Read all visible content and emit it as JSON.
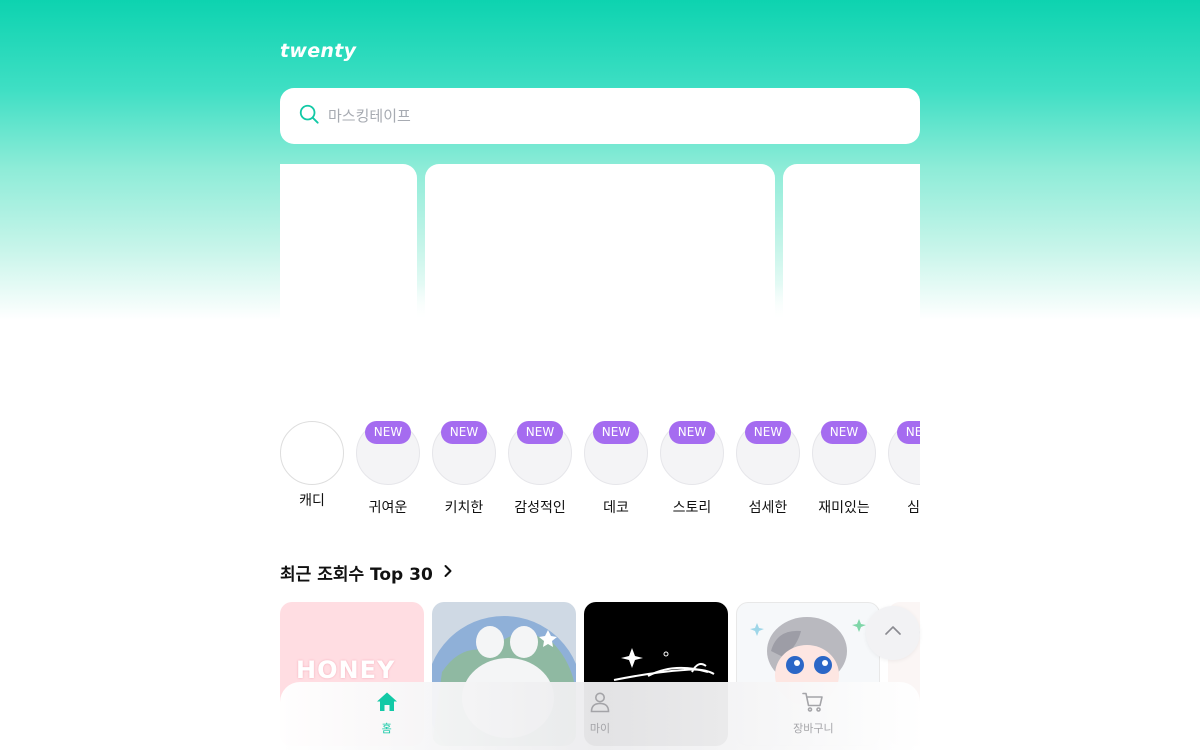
{
  "app": {
    "logo": "twenty"
  },
  "search": {
    "placeholder": "마스킹테이프"
  },
  "categories": [
    {
      "label": "캐디",
      "badge": ""
    },
    {
      "label": "귀여운",
      "badge": "NEW"
    },
    {
      "label": "키치한",
      "badge": "NEW"
    },
    {
      "label": "감성적인",
      "badge": "NEW"
    },
    {
      "label": "데코",
      "badge": "NEW"
    },
    {
      "label": "스토리",
      "badge": "NEW"
    },
    {
      "label": "섬세한",
      "badge": "NEW"
    },
    {
      "label": "재미있는",
      "badge": "NEW"
    },
    {
      "label": "심플",
      "badge": "NEW"
    }
  ],
  "section": {
    "title": "최근 조회수 Top 30"
  },
  "products": {
    "first_text": "HONEY"
  },
  "nav": {
    "home": "홈",
    "my": "마이",
    "cart": "장바구니"
  },
  "colors": {
    "accent": "#12c9a6",
    "badge": "#a56cf0",
    "gradient_top": "#0dd3b0"
  },
  "icons": [
    "search-icon",
    "chevron-right-icon",
    "chevron-up-icon",
    "home-icon",
    "person-icon",
    "cart-icon"
  ]
}
